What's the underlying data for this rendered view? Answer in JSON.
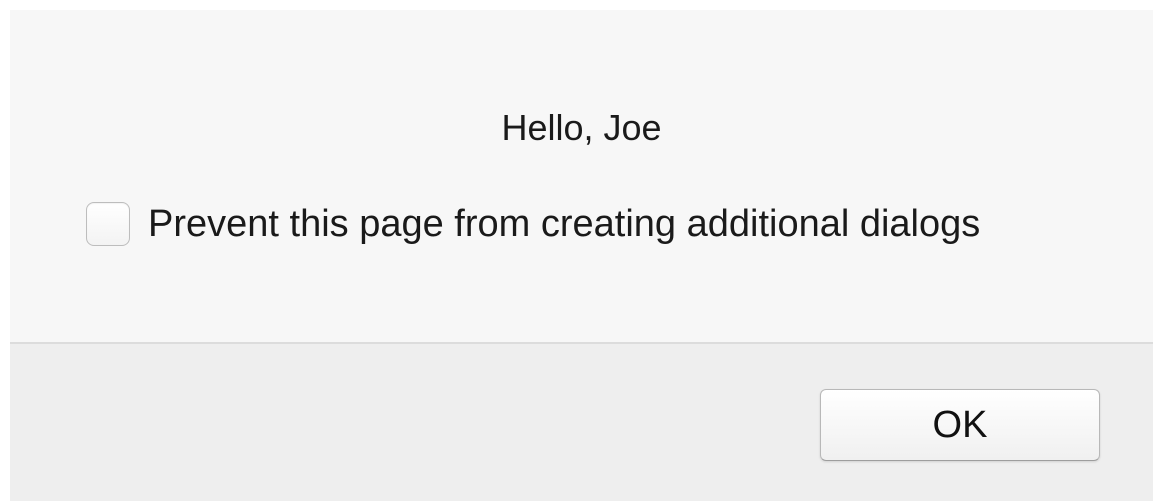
{
  "dialog": {
    "message": "Hello, Joe",
    "prevent_checkbox": {
      "label": "Prevent this page from creating additional dialogs",
      "checked": false
    },
    "ok_label": "OK"
  },
  "colors": {
    "content_background": "#f7f7f7",
    "footer_background": "#eeeeee",
    "divider": "#dcdcdc",
    "text": "#1a1a1a"
  }
}
